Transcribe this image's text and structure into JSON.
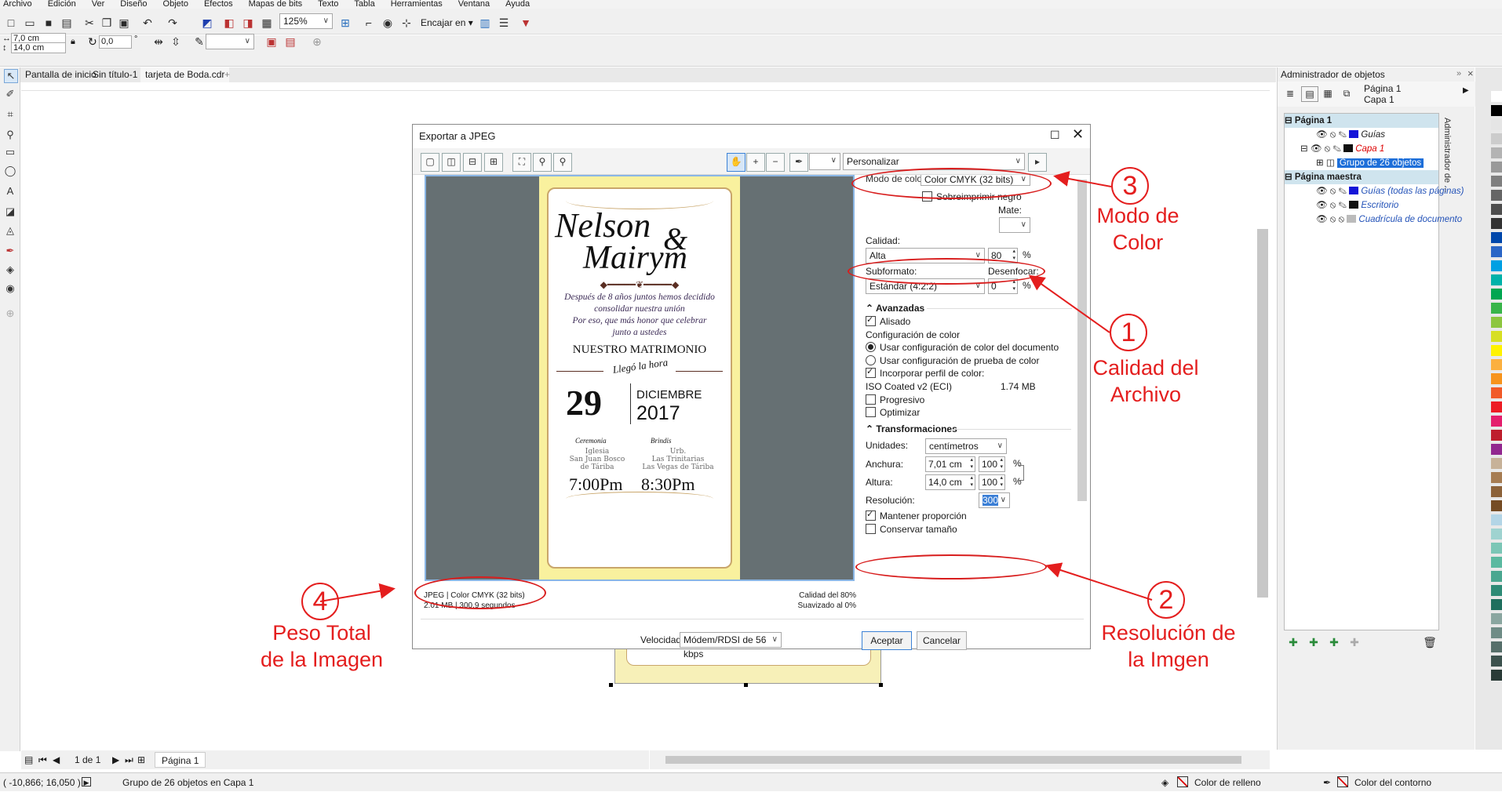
{
  "menu": [
    "Archivo",
    "Edición",
    "Ver",
    "Diseño",
    "Objeto",
    "Efectos",
    "Mapas de bits",
    "Texto",
    "Tabla",
    "Herramientas",
    "Ventana",
    "Ayuda"
  ],
  "toolbar": {
    "zoom": "125%",
    "snap_label": "Encajar en"
  },
  "propbar": {
    "width": "7,0 cm",
    "height": "14,0 cm",
    "angle": "0,0",
    "degree": "°"
  },
  "tabs": [
    "Pantalla de inicio",
    "Sin título-1",
    "tarjeta de Boda.cdr"
  ],
  "dialog": {
    "title": "Exportar a JPEG",
    "preset": "Personalizar",
    "color_mode_label": "Modo de color:",
    "color_mode_value": "Color CMYK (32 bits)",
    "overprint_label": "Sobreimprimir negro",
    "matte_label": "Mate:",
    "quality_label": "Calidad:",
    "quality_value": "Alta",
    "quality_number": "80",
    "percent": "%",
    "subformat_label": "Subformato:",
    "subformat_value": "Estándar (4:2:2)",
    "blur_label": "Desenfocar:",
    "blur_value": "0",
    "advanced_label": "Avanzadas",
    "antialias_label": "Alisado",
    "color_config_label": "Configuración de color",
    "radio1_label": "Usar configuración de color del documento",
    "radio2_label": "Usar configuración de prueba de color",
    "embed_label": "Incorporar perfil de color:",
    "profile_name": "ISO Coated v2 (ECI)",
    "profile_size": "1.74 MB",
    "progressive_label": "Progresivo",
    "optimize_label": "Optimizar",
    "transforms_label": "Transformaciones",
    "units_label": "Unidades:",
    "units_value": "centímetros",
    "width_label": "Anchura:",
    "width_value": "7,01 cm",
    "width_pct": "100",
    "height_label": "Altura:",
    "height_value": "14,0 cm",
    "height_pct": "100",
    "resolution_label": "Resolución:",
    "resolution_value": "300",
    "keep_ratio_label": "Mantener proporción",
    "keep_size_label": "Conservar tamaño",
    "info_format": "JPEG  |  Color CMYK (32 bits)",
    "info_size": "2.01 MB  |  300.9 segundos",
    "info_quality": "Calidad del 80%",
    "info_smooth": "Suavizado al 0%",
    "speed_label": "Velocidad:",
    "speed_value": "Módem/RDSI de 56 kbps",
    "accept": "Aceptar",
    "cancel": "Cancelar"
  },
  "card": {
    "name1": "Nelson",
    "amp": "&",
    "name2": "Mairym",
    "text1": "Después de 8 años juntos hemos decidido",
    "text2": "consolidar nuestra unión",
    "text3": "Por eso, que más honor que celebrar",
    "text4": "junto a ustedes",
    "heading": "NUESTRO MATRIMONIO",
    "arc": "Llegó la hora",
    "day": "29",
    "month": "DICIEMBRE",
    "year": "2017",
    "ceremony": "Ceremonia",
    "brindis": "Brindis",
    "place1a": "Iglesia",
    "place1b": "San Juan Bosco",
    "place1c": "de Táriba",
    "place2a": "Urb.",
    "place2b": "Las Trinitarias",
    "place2c": "Las Vegas de Táriba",
    "time1": "7:00Pm",
    "time2": "8:30Pm"
  },
  "annotations": {
    "n1": "1",
    "a1_line1": "Calidad del",
    "a1_line2": "Archivo",
    "n2": "2",
    "a2_line1": "Resolución de",
    "a2_line2": "la Imgen",
    "n3": "3",
    "a3_line1": "Modo de",
    "a3_line2": "Color",
    "n4": "4",
    "a4_line1": "Peso Total",
    "a4_line2": "de la Imagen"
  },
  "object_manager": {
    "title": "Administrador de objetos",
    "page": "Página 1",
    "layer": "Capa 1",
    "tree_page": "Página 1",
    "guides": "Guías",
    "layer_item": "Capa 1",
    "group": "Grupo de 26 objetos",
    "master": "Página maestra",
    "master_guides": "Guías (todas las páginas)",
    "desktop": "Escritorio",
    "grid": "Cuadrícula de documento",
    "side_tab": "Administrador de ..."
  },
  "pagebar": {
    "count": "1 de 1",
    "page_tab": "Página 1"
  },
  "status": {
    "coords": "( -10,866; 16,050 )",
    "selection": "Grupo de 26 objetos en Capa 1",
    "fill": "Color de relleno",
    "outline": "Color del contorno"
  },
  "colors": {
    "annotation": "#e41e1e",
    "card_bg": "#f9f19e",
    "selection": "#1e6fd9"
  }
}
